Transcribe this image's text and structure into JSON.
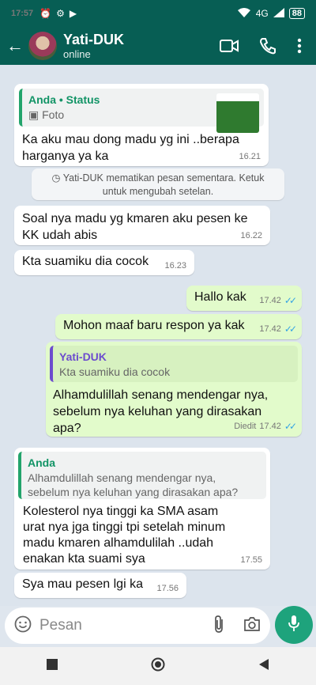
{
  "status": {
    "time": "17:57",
    "network": "4G",
    "battery": "88"
  },
  "header": {
    "contact_name": "Yati-DUK",
    "contact_status": "online"
  },
  "messages": {
    "m1": {
      "quote_name": "Anda • Status",
      "quote_text": "Foto",
      "text": "Ka aku mau dong madu yg ini ..berapa harganya ya ka",
      "time": "16.21"
    },
    "system": "Yati-DUK mematikan pesan sementara. Ketuk untuk mengubah setelan.",
    "m2": {
      "text": "Soal nya madu yg kmaren aku pesen ke KK udah abis",
      "time": "16.22"
    },
    "m3": {
      "text": "Kta suamiku dia cocok",
      "time": "16.23"
    },
    "m4": {
      "text": "Hallo kak",
      "time": "17.42"
    },
    "m5": {
      "text": "Mohon maaf baru respon ya kak",
      "time": "17.42"
    },
    "m6": {
      "quote_name": "Yati-DUK",
      "quote_text": "Kta suamiku dia cocok",
      "text": "Alhamdulillah senang mendengar nya, sebelum nya keluhan yang dirasakan apa?",
      "edited": "Diedit",
      "time": "17.42"
    },
    "m7": {
      "quote_name": "Anda",
      "quote_text": "Alhamdulillah senang mendengar nya, sebelum nya keluhan yang dirasakan apa?",
      "text": "Kolesterol nya tinggi ka SMA asam urat nya jga tinggi tpi setelah minum madu kmaren alhamdulilah ..udah enakan kta suami sya",
      "time": "17.55"
    },
    "m8": {
      "text": "Sya mau pesen lgi ka",
      "time": "17.56"
    }
  },
  "composer": {
    "placeholder": "Pesan"
  },
  "colors": {
    "header": "#075e54",
    "outgoing": "#e2fbcb",
    "accent": "#1ea37c",
    "ticks": "#34a4e4"
  }
}
